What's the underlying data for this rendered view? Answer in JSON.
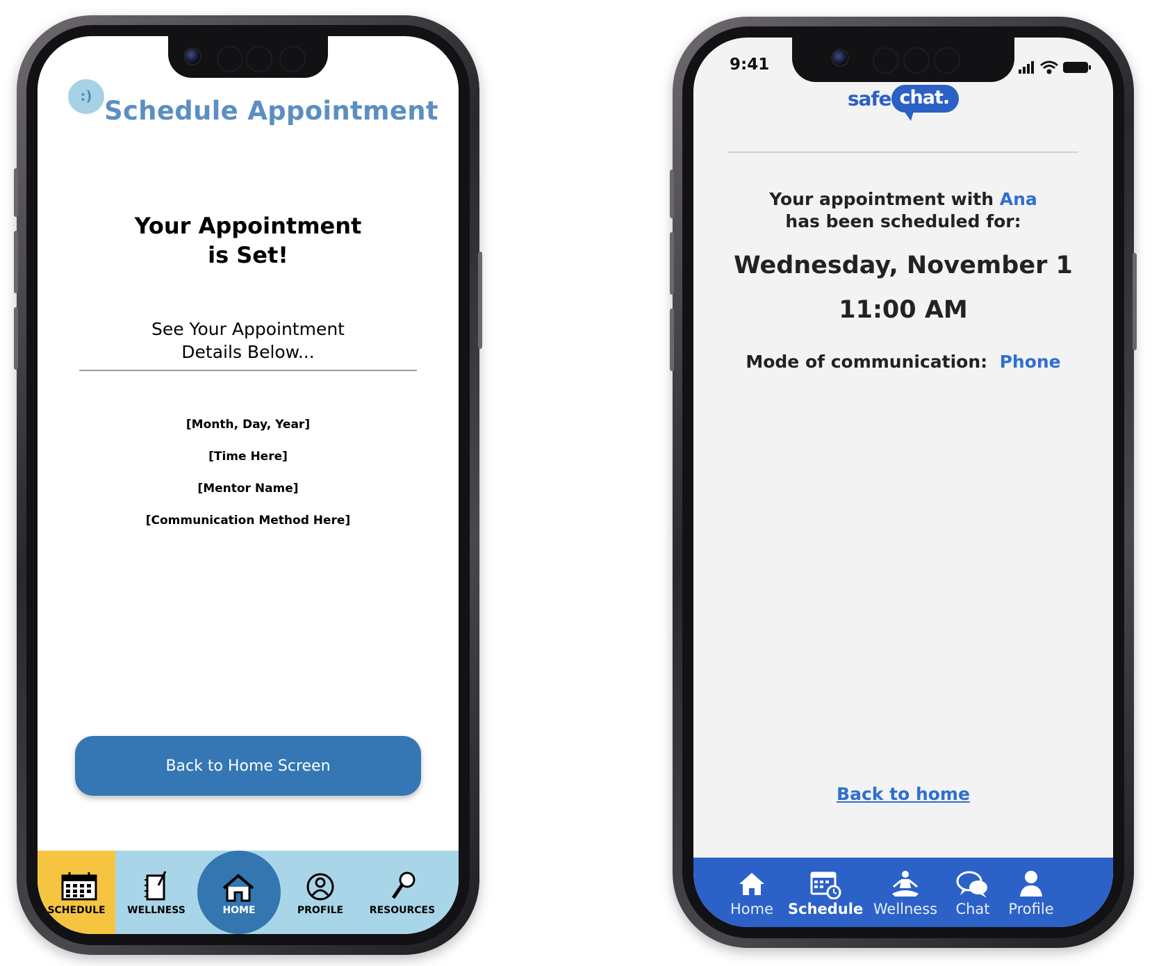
{
  "left_app": {
    "logo_text": ":)",
    "title": "Schedule Appointment",
    "heading_line1": "Your Appointment",
    "heading_line2": "is Set!",
    "subtitle_line1": "See Your Appointment",
    "subtitle_line2": "Details Below...",
    "details": [
      "[Month, Day, Year]",
      "[Time Here]",
      "[Mentor Name]",
      "[Communication Method Here]"
    ],
    "button_label": "Back to Home Screen",
    "nav": [
      {
        "label": "SCHEDULE",
        "icon": "calendar-icon",
        "active": true
      },
      {
        "label": "WELLNESS",
        "icon": "notebook-icon",
        "active": false
      },
      {
        "label": "HOME",
        "icon": "home-icon",
        "active": false
      },
      {
        "label": "PROFILE",
        "icon": "profile-icon",
        "active": false
      },
      {
        "label": "RESOURCES",
        "icon": "magnifier-icon",
        "active": false
      }
    ],
    "colors": {
      "title": "#5b8fc0",
      "button": "#3477b4",
      "nav_bg": "#a9d5e8",
      "nav_active": "#f5c542",
      "home_circle": "#3376b0"
    }
  },
  "right_app": {
    "status_time": "9:41",
    "logo_safe": "safe",
    "logo_chat": "chat.",
    "message_prefix": "Your appointment with",
    "mentor_name": "Ana",
    "message_line2": "has been scheduled for:",
    "date": "Wednesday, November 1",
    "time": "11:00 AM",
    "mode_label": "Mode of communication:",
    "mode_value": "Phone",
    "back_link": "Back to home",
    "nav": [
      {
        "label": "Home",
        "icon": "home-icon",
        "active": false
      },
      {
        "label": "Schedule",
        "icon": "calendar-clock-icon",
        "active": true
      },
      {
        "label": "Wellness",
        "icon": "meditation-icon",
        "active": false
      },
      {
        "label": "Chat",
        "icon": "chat-bubbles-icon",
        "active": false
      },
      {
        "label": "Profile",
        "icon": "person-icon",
        "active": false
      }
    ],
    "colors": {
      "accent": "#2f6fcf",
      "nav_bg": "#2c62c8",
      "screen_bg": "#f3f3f3"
    }
  }
}
